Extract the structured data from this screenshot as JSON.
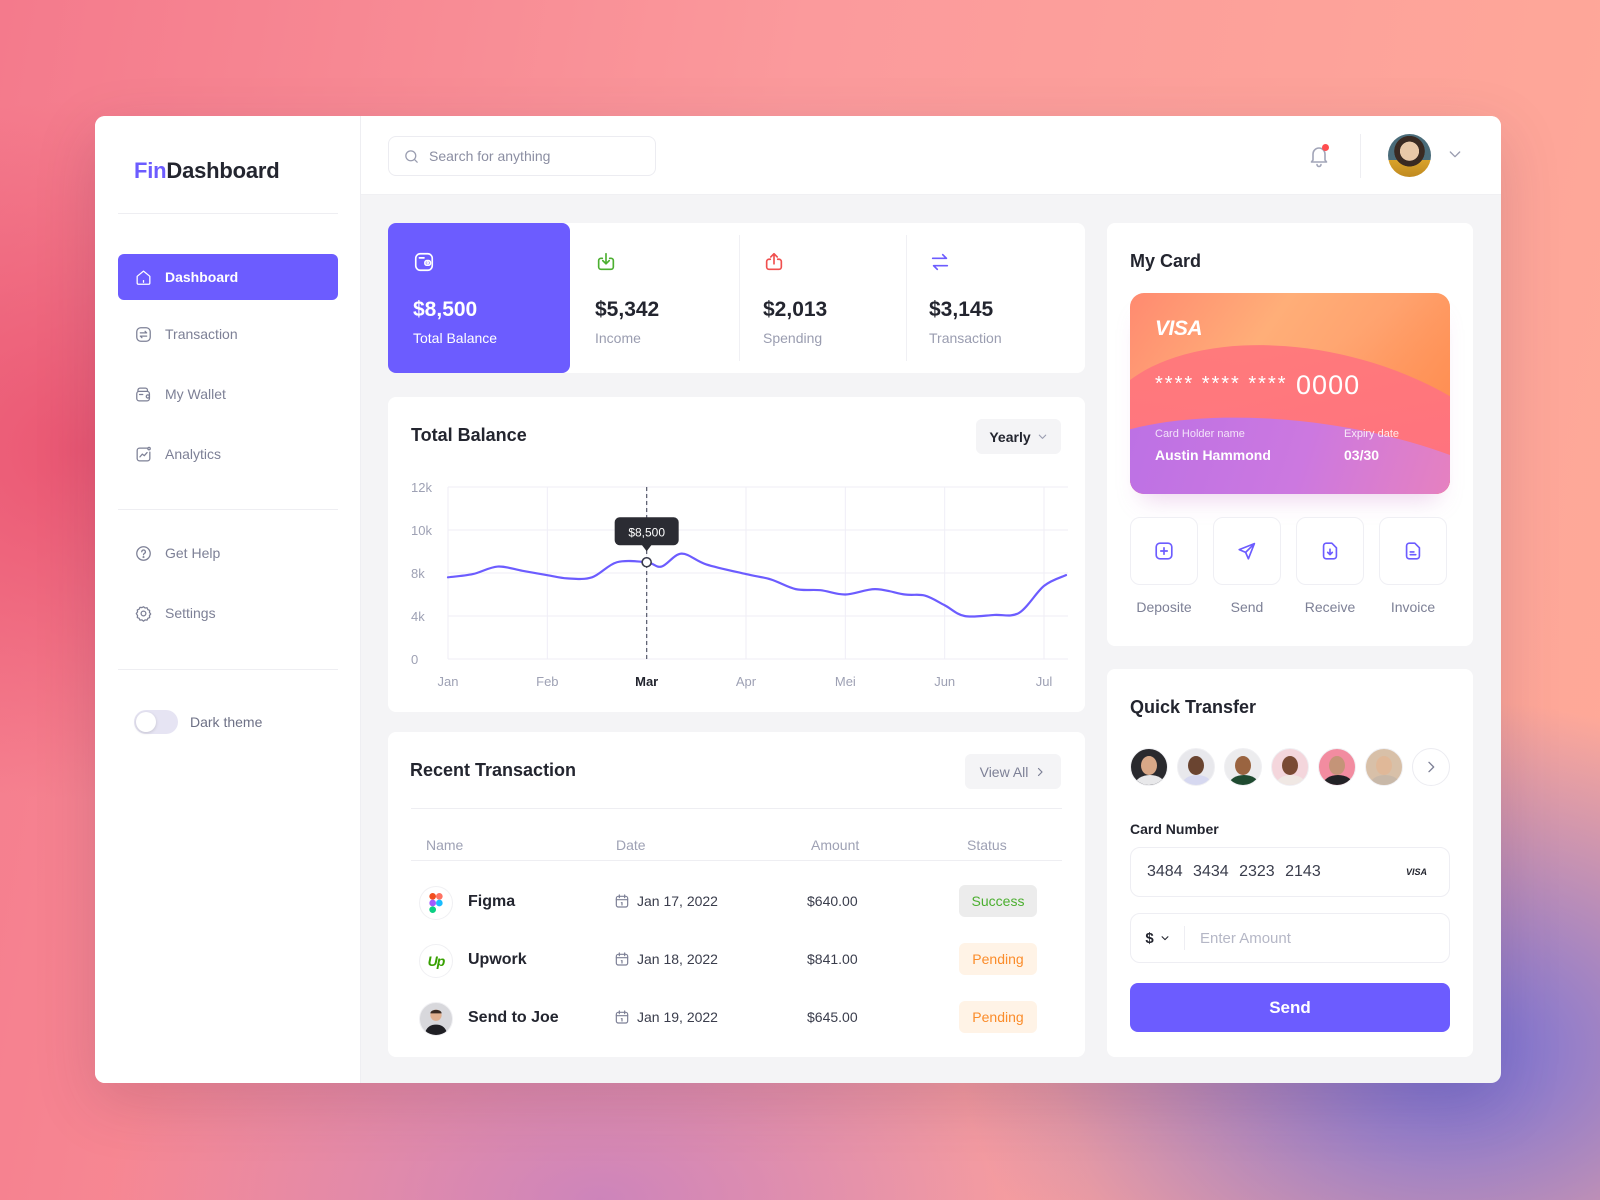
{
  "app": {
    "logo_prefix": "Fin",
    "logo_suffix": "Dashboard",
    "accent_color": "#6c5cff"
  },
  "sidebar": {
    "items": [
      {
        "label": "Dashboard",
        "icon": "home-icon",
        "active": true
      },
      {
        "label": "Transaction",
        "icon": "transfer-icon",
        "active": false
      },
      {
        "label": "My Wallet",
        "icon": "wallet-icon",
        "active": false
      },
      {
        "label": "Analytics",
        "icon": "analytics-icon",
        "active": false
      }
    ],
    "secondary_items": [
      {
        "label": "Get Help",
        "icon": "help-icon"
      },
      {
        "label": "Settings",
        "icon": "gear-icon"
      }
    ],
    "dark_theme": {
      "label": "Dark theme",
      "enabled": false
    }
  },
  "topbar": {
    "search_placeholder": "Search for anything",
    "notification_unread": true
  },
  "stats": [
    {
      "value": "$8,500",
      "label": "Total Balance",
      "icon": "wallet-icon",
      "color": "#ffffff",
      "highlight": true
    },
    {
      "value": "$5,342",
      "label": "Income",
      "icon": "download-icon",
      "color": "#4caf30"
    },
    {
      "value": "$2,013",
      "label": "Spending",
      "icon": "upload-icon",
      "color": "#f0504f"
    },
    {
      "value": "$3,145",
      "label": "Transaction",
      "icon": "arrows-icon",
      "color": "#6c5cff"
    }
  ],
  "balance_chart": {
    "title": "Total Balance",
    "period_select": "Yearly"
  },
  "chart_data": {
    "type": "line",
    "title": "Total Balance",
    "xlabel": "",
    "ylabel": "",
    "x_ticks": [
      "Jan",
      "Feb",
      "Mar",
      "Apr",
      "Mei",
      "Jun",
      "Jul"
    ],
    "highlighted_tick": "Mar",
    "y_ticks": [
      "0",
      "4k",
      "8k",
      "10k",
      "12k"
    ],
    "grid": true,
    "series": [
      {
        "name": "Total Balance",
        "color": "#6c5cff",
        "x": [
          0,
          0.25,
          0.5,
          0.75,
          1.0,
          1.2,
          1.45,
          1.7,
          2.0,
          2.15,
          2.35,
          2.6,
          3.0,
          3.25,
          3.5,
          3.75,
          4.0,
          4.3,
          4.6,
          4.8,
          5.0,
          5.2,
          5.5,
          5.75,
          6.0,
          6.25
        ],
        "y": [
          7.6,
          7.9,
          8.3,
          8.1,
          7.8,
          7.5,
          7.6,
          8.5,
          8.5,
          8.3,
          8.9,
          8.4,
          7.9,
          7.4,
          6.5,
          6.4,
          6.0,
          6.5,
          6.0,
          5.9,
          5.0,
          4.0,
          4.1,
          4.3,
          6.8,
          7.8
        ]
      }
    ],
    "tooltip": {
      "x": "Mar",
      "label": "$8,500"
    },
    "y_unit_note": "y values in thousands (k)"
  },
  "transactions": {
    "title": "Recent Transaction",
    "view_all": "View All",
    "columns": [
      "Name",
      "Date",
      "Amount",
      "Status"
    ],
    "rows": [
      {
        "name": "Figma",
        "logo": "figma-logo",
        "date": "Jan 17, 2022",
        "amount": "$640.00",
        "status": "Success"
      },
      {
        "name": "Upwork",
        "logo": "upwork-logo",
        "date": "Jan 18, 2022",
        "amount": "$841.00",
        "status": "Pending"
      },
      {
        "name": "Send to Joe",
        "logo": "avatar",
        "date": "Jan 19, 2022",
        "amount": "$645.00",
        "status": "Pending"
      }
    ]
  },
  "my_card": {
    "title": "My Card",
    "brand": "VISA",
    "masked": "**** **** ****",
    "last4": "0000",
    "holder_label": "Card Holder name",
    "holder": "Austin Hammond",
    "expiry_label": "Expiry date",
    "expiry": "03/30",
    "actions": [
      {
        "label": "Deposite",
        "icon": "plus-square-icon"
      },
      {
        "label": "Send",
        "icon": "send-icon"
      },
      {
        "label": "Receive",
        "icon": "receive-doc-icon"
      },
      {
        "label": "Invoice",
        "icon": "invoice-icon"
      }
    ]
  },
  "quick_transfer": {
    "title": "Quick Transfer",
    "contacts_count": 6,
    "card_number_label": "Card Number",
    "card_number": "3484 3434 2323 2143",
    "card_brand": "VISA",
    "currency": "$",
    "amount_placeholder": "Enter Amount",
    "send_label": "Send"
  }
}
